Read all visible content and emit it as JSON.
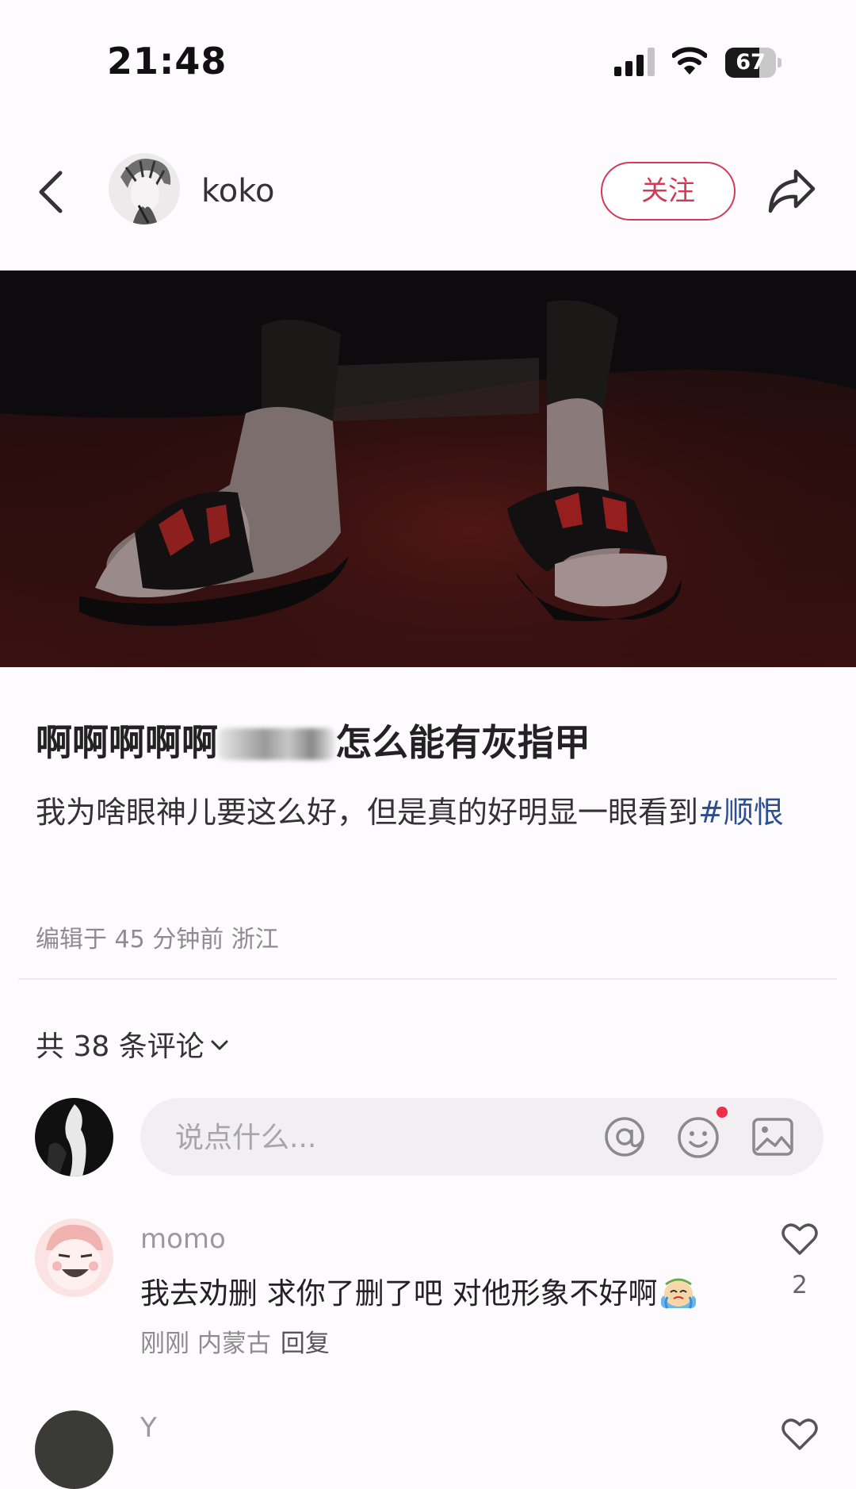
{
  "status_bar": {
    "time": "21:48",
    "battery": "67",
    "battery_level": 0.67
  },
  "header": {
    "back_icon": "chevron-left-icon",
    "author_name": "koko",
    "follow_label": "关注",
    "share_icon": "share-icon",
    "accent_color": "#d33a57"
  },
  "post": {
    "title_prefix": "啊啊啊啊啊",
    "title_suffix": "怎么能有灰指甲",
    "body_text": "我为啥眼神儿要这么好，但是真的好明显一眼看到",
    "body_tag": "#顺恨",
    "meta": "编辑于 45 分钟前 浙江"
  },
  "comments_section": {
    "count_label": "共 38 条评论",
    "input_placeholder": "说点什么...",
    "icons": [
      "at-icon",
      "emoji-icon",
      "image-icon"
    ]
  },
  "comments": [
    {
      "user": "momo",
      "text": "我去劝删 求你了删了吧 对他形象不好啊",
      "time": "刚刚",
      "location": "内蒙古",
      "reply_label": "回复",
      "likes": "2"
    },
    {
      "user": "Y"
    }
  ]
}
